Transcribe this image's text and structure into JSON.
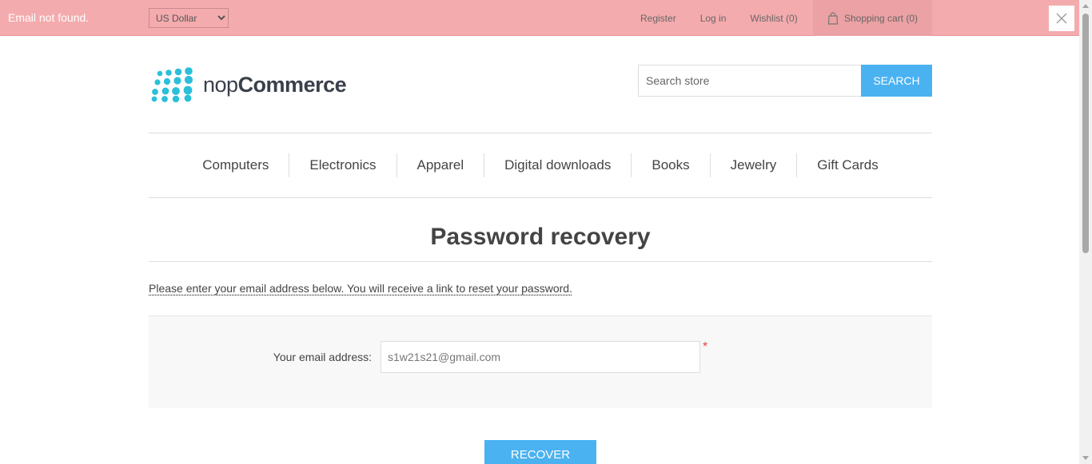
{
  "notification": {
    "message": "Email not found.",
    "close_icon": "close-icon",
    "bg_color": "#f4abae"
  },
  "header": {
    "currency": {
      "selected": "US Dollar",
      "options": [
        "US Dollar"
      ]
    },
    "links": {
      "register": "Register",
      "login": "Log in",
      "wishlist": "Wishlist (0)",
      "cart": "Shopping cart (0)"
    },
    "logo": {
      "brand_light": "nop",
      "brand_bold": "Commerce",
      "accent_color": "#2bbfd9"
    },
    "search": {
      "placeholder": "Search store",
      "button": "SEARCH",
      "accent_color": "#4ab2f1"
    }
  },
  "menu": [
    "Computers",
    "Electronics",
    "Apparel",
    "Digital downloads",
    "Books",
    "Jewelry",
    "Gift Cards"
  ],
  "main": {
    "title": "Password recovery",
    "tooltip": "Please enter your email address below. You will receive a link to reset your password.",
    "form": {
      "email_label": "Your email address:",
      "email_value": "s1w21s21@gmail.com",
      "required_marker": "*"
    },
    "recover_button": "RECOVER"
  }
}
